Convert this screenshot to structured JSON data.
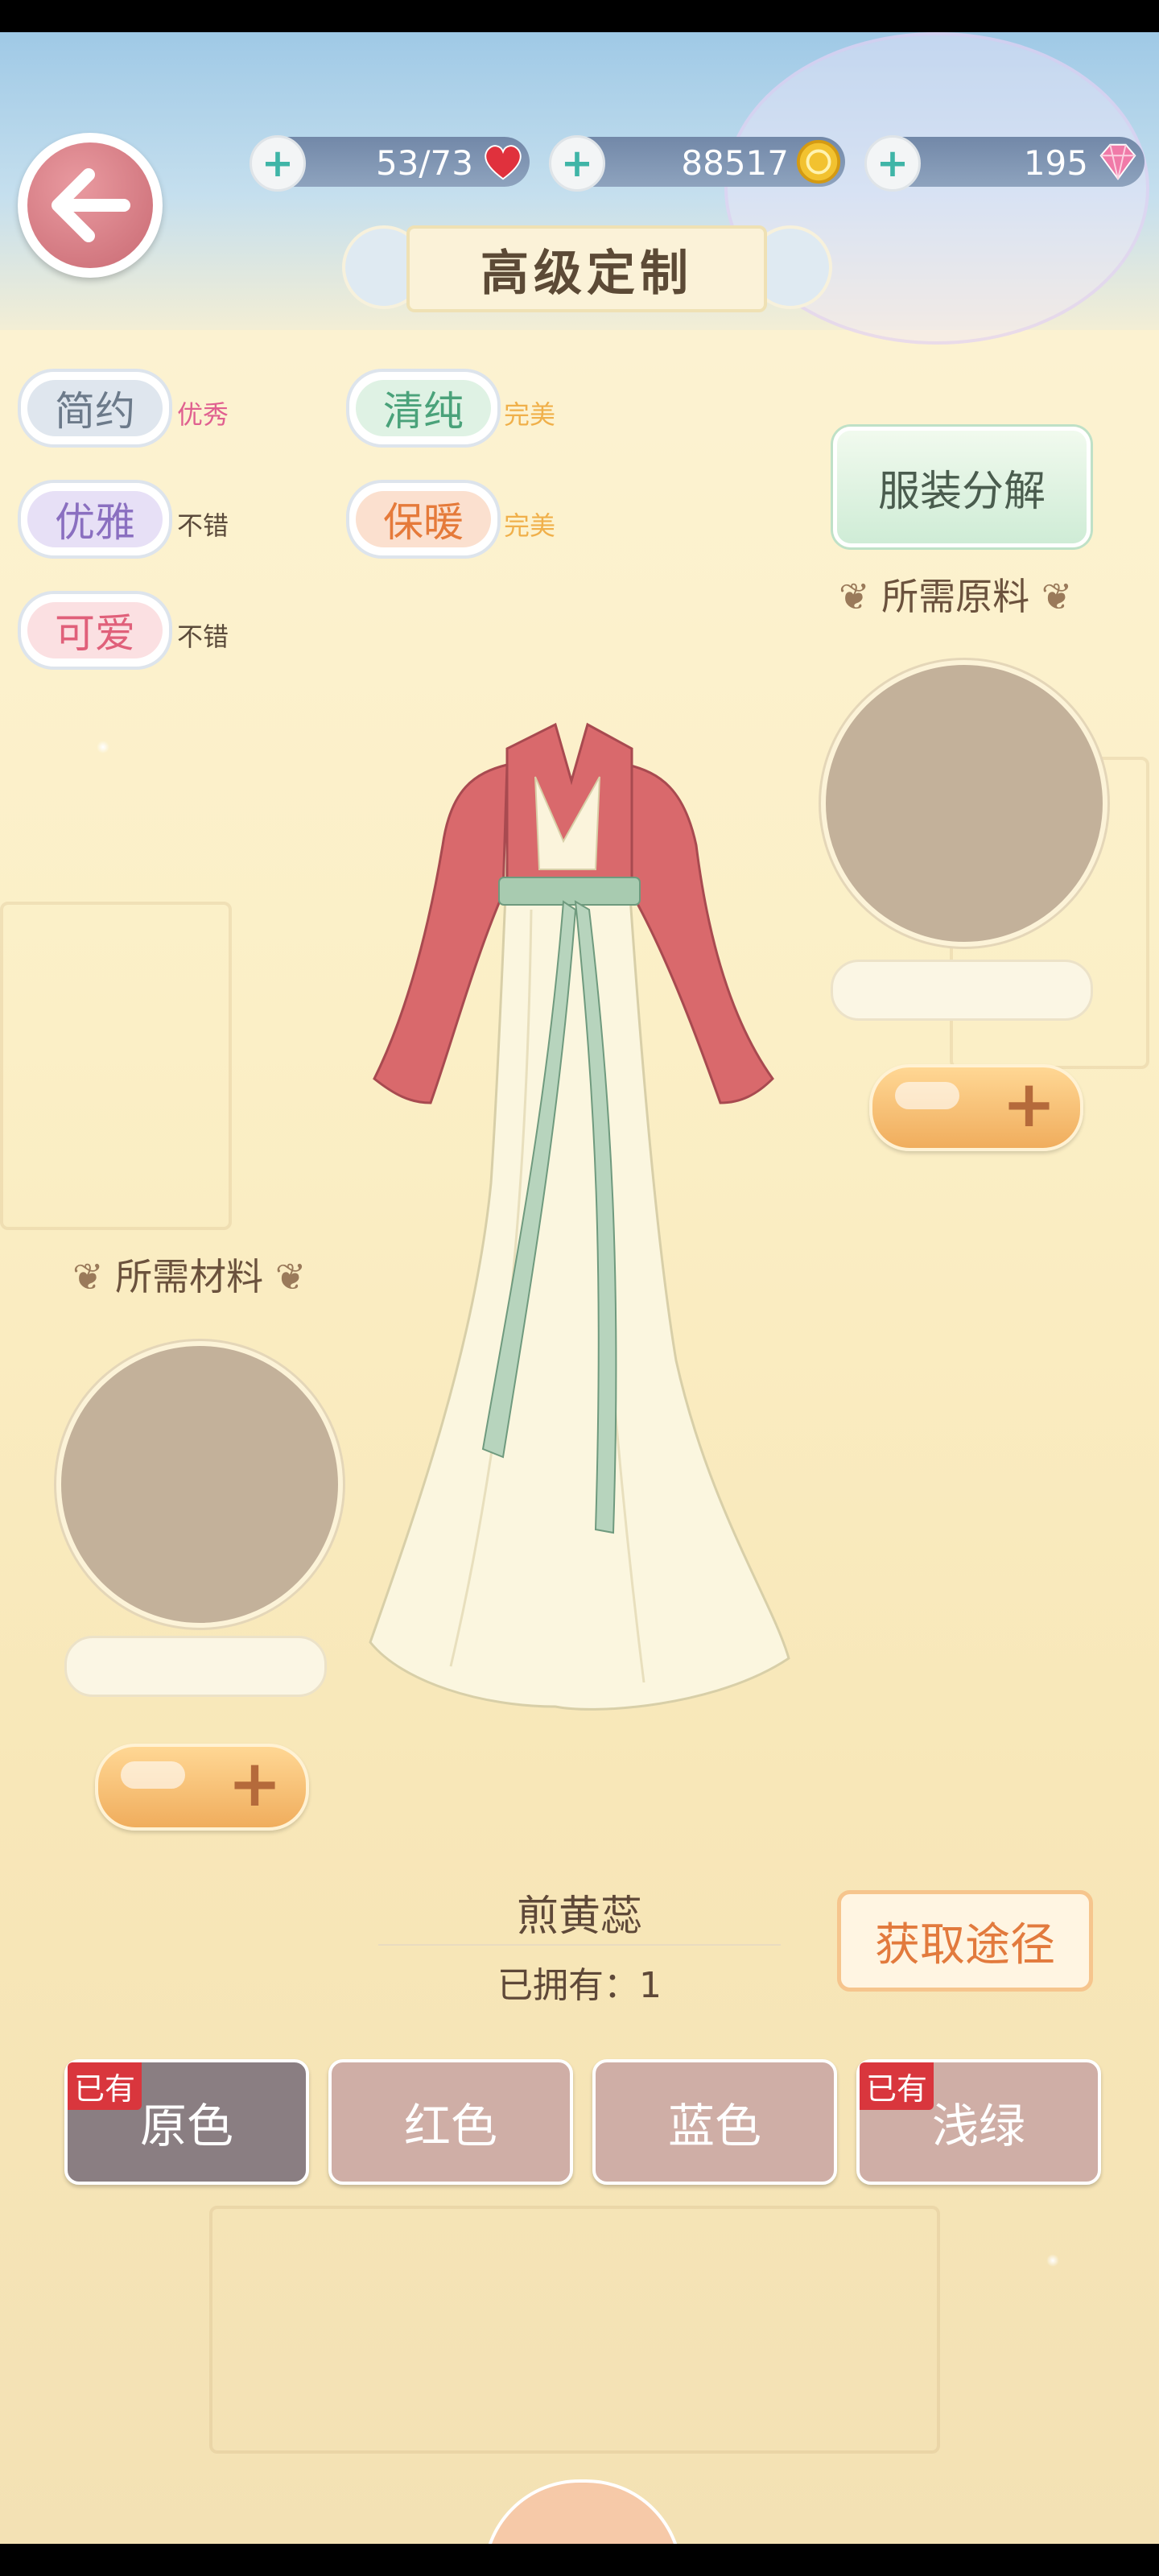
{
  "header": {
    "title": "高级定制",
    "stamina": "53/73",
    "gold": "88517",
    "diamonds": "195"
  },
  "attributes": [
    {
      "label": "简约",
      "grade": "优秀",
      "grade_color": "#e06090",
      "pill_color": "#dfe6ee",
      "text_color": "#6c7a8a"
    },
    {
      "label": "清纯",
      "grade": "完美",
      "grade_color": "#f0b04a",
      "pill_color": "#dff2e4",
      "text_color": "#4aa27a"
    },
    {
      "label": "优雅",
      "grade": "不错",
      "grade_color": "#5a4a3a",
      "pill_color": "#e7e0f6",
      "text_color": "#8a6fc0"
    },
    {
      "label": "保暖",
      "grade": "完美",
      "grade_color": "#f0b04a",
      "pill_color": "#fbe0cf",
      "text_color": "#e57a3a"
    },
    {
      "label": "可爱",
      "grade": "不错",
      "grade_color": "#5a4a3a",
      "pill_color": "#fbe0e2",
      "text_color": "#e0607a"
    }
  ],
  "decompose_button": "服装分解",
  "raw_material_label": "所需原料",
  "material_label": "所需材料",
  "item": {
    "name": "煎黄蕊",
    "owned": "已拥有：1"
  },
  "source_button": "获取途径",
  "owned_tag": "已有",
  "colors": [
    {
      "label": "原色",
      "owned": true,
      "bg": "#8a7e82"
    },
    {
      "label": "红色",
      "owned": false,
      "bg": "#cfaea6"
    },
    {
      "label": "蓝色",
      "owned": false,
      "bg": "#cfaea6"
    },
    {
      "label": "浅绿",
      "owned": true,
      "bg": "#cfaea6"
    }
  ]
}
